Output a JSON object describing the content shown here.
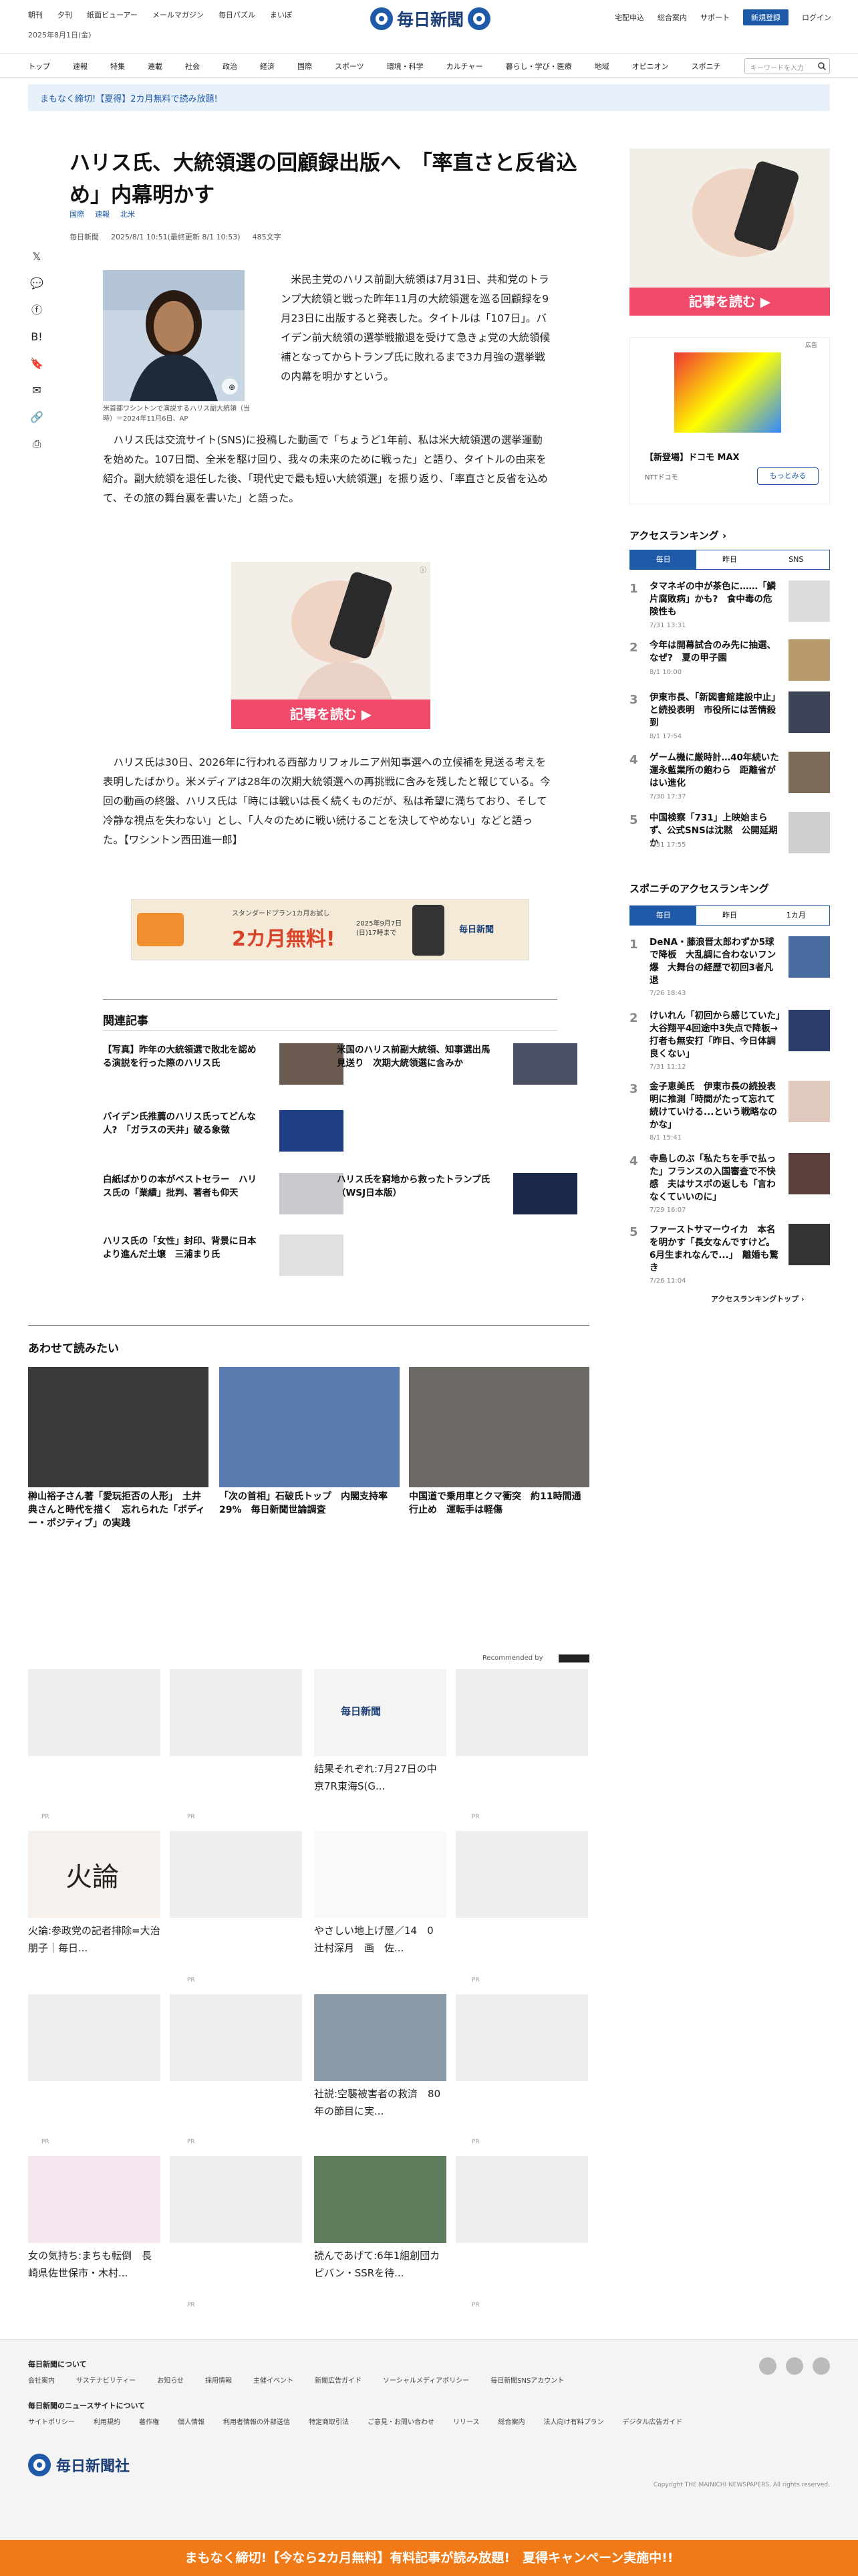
{
  "header": {
    "top_links": [
      "朝刊",
      "夕刊",
      "紙面ビューアー",
      "メールマガジン",
      "毎日パズル",
      "まいぽ"
    ],
    "right_links": [
      "宅配申込",
      "総合案内",
      "サポート"
    ],
    "register": "新規登録",
    "login": "ログイン",
    "date": "2025年8月1日(金)",
    "logo": "毎日新聞"
  },
  "nav": {
    "items": [
      "トップ",
      "速報",
      "特集",
      "連載",
      "社会",
      "政治",
      "経済",
      "国際",
      "スポーツ",
      "環境・科学",
      "カルチャー",
      "暮らし・学び・医療",
      "地域",
      "オピニオン",
      "スポニチ"
    ],
    "search_placeholder": "キーワードを入力"
  },
  "banner": "まもなく締切!【夏得】2カ月無料で読み放題!",
  "article": {
    "title": "ハリス氏、大統領選の回顧録出版へ　「率直さと反省込め」内幕明かす",
    "tags": [
      "国際",
      "速報",
      "北米"
    ],
    "meta": [
      "毎日新聞",
      "2025/8/1 10:51(最終更新 8/1 10:53)",
      "485文字"
    ],
    "caption": "米首都ワシントンで演説するハリス副大統領（当時）＝2024年11月6日、AP",
    "p1": "米民主党のハリス前副大統領は7月31日、共和党のトランプ大統領と戦った昨年11月の大統領選を巡る回顧録を9月23日に出版すると発表した。タイトルは「107日」。バイデン前大統領の選挙戦撤退を受けて急きょ党の大統領候補となってからトランプ氏に敗れるまで3カ月強の選挙戦の内幕を明かすという。",
    "p2": "ハリス氏は交流サイト(SNS)に投稿した動画で「ちょうど1年前、私は米大統領選の選挙運動を始めた。107日間、全米を駆け回り、我々の未来のために戦った」と語り、タイトルの由来を紹介。副大統領を退任した後、「現代史で最も短い大統領選」を振り返り、「率直さと反省を込めて、その旅の舞台裏を書いた」と語った。",
    "p3": "ハリス氏は30日、2026年に行われる西部カリフォルニア州知事選への立候補を見送る考えを表明したばかり。米メディアは28年の次期大統領選への再挑戦に含みを残したと報じている。今回の動画の終盤、ハリス氏は「時には戦いは長く続くものだが、私は希望に満ちており、そして冷静な視点を失わない」とし、「人々のために戦い続けることを決してやめない」などと語った。【ワシントン西田進一郎】"
  },
  "ads": {
    "read_button": "記事を読む",
    "mid_banner": "スタンダードプラン1カ月お試し",
    "mid_banner_main": "2カ月無料!",
    "mid_banner_date": "2025年9月7日(日)17時まで",
    "docomo": "【新登場】ドコモ MAX",
    "docomo_sub": "NTTドコモ",
    "docomo_btn": "もっとみる",
    "docomo_label": "広告",
    "recommended": "Recommended by"
  },
  "related": {
    "heading": "関連記事",
    "items": [
      "【写真】昨年の大統領選で敗北を認める演説を行った際のハリス氏",
      "米国のハリス前副大統領、知事選出馬見送り　次期大統領選に含みか",
      "バイデン氏推薦のハリス氏ってどんな人?　「ガラスの天井」破る象徴",
      "",
      "白紙ばかりの本がベストセラー　ハリス氏の「業績」批判、著者も仰天",
      "ハリス氏を窮地から救ったトランプ氏（WSJ日本版）",
      "ハリス氏の「女性」封印、背景に日本より進んだ土壌　三浦まり氏"
    ]
  },
  "also_read": {
    "heading": "あわせて読みたい",
    "items": [
      "榊山裕子さん著「愛玩拒否の人形」　土井典さんと時代を描く　忘れられた「ボディー・ポジティブ」の実践",
      "「次の首相」石破氏トップ　内閣支持率29%　毎日新聞世論調査",
      "中国道で乗用車とクマ衝突　約11時間通行止め　運転手は軽傷"
    ]
  },
  "grid": {
    "pr": "PR",
    "titles": [
      "結果それぞれ:7月27日の中京7R東海S(G...",
      "火論:参政党の記者排除=大治朋子｜毎日...",
      "やさしい地上げ屋／14　0　辻村深月　画　佐...",
      "社説:空襲被害者の救済　80年の節目に実...",
      "女の気持ち:まちも転倒　長崎県佐世保市・木村...",
      "読んであげて:6年1組創団カピバン・SSRを待..."
    ]
  },
  "ranking": {
    "heading": "アクセスランキング",
    "tabs": [
      "毎日",
      "昨日",
      "SNS"
    ],
    "items": [
      {
        "t": "タマネギの中が茶色に……「鱗片腐敗病」かも?　食中毒の危険性も",
        "d": "7/31 13:31"
      },
      {
        "t": "今年は開幕試合のみ先に抽選、なぜ?　夏の甲子園",
        "d": "8/1 10:00"
      },
      {
        "t": "伊東市長、「新図書館建設中止」と続投表明　市役所には苦情殺到",
        "d": "8/1 17:54"
      },
      {
        "t": "ゲーム機に厳時計…40年続いた運永藍業所の飽わら　距離省がはい進化",
        "d": "7/30 17:37"
      },
      {
        "t": "中国検察「731」上映始まらず、公式SNSは沈黙　公開延期か",
        "d": "7/31 17:55"
      }
    ],
    "sponichi_heading": "スポニチのアクセスランキング",
    "sponichi_tabs": [
      "毎日",
      "昨日",
      "1カ月"
    ],
    "sponichi": [
      {
        "t": "DeNA・藤浪晋太郎わずか5球で降板　大乱調に合わないフン爆　大舞台の経歴で初回3者凡退",
        "d": "7/26 18:43"
      },
      {
        "t": "けいれん「初回から感じていた」大谷翔平4回途中3失点で降板→打者も無安打「昨日、今日体調良くない」",
        "d": "7/31 11:12"
      },
      {
        "t": "金子恵美氏　伊東市長の続投表明に推測「時間がたって忘れて続けていける...という戦略なのかな」",
        "d": "8/1 15:41"
      },
      {
        "t": "寺島しのぶ「私たちを手で払った」フランスの入国審査で不快感　夫はサスポの返しも「言わなくていいのに」",
        "d": "7/29 16:07"
      },
      {
        "t": "ファーストサマーウイカ　本名を明かす「長女なんですけど。6月生まれなんで...」　離婚も驚き",
        "d": "7/26 11:04"
      }
    ],
    "more": "アクセスランキングトップ"
  },
  "footer": {
    "about": "毎日新聞について",
    "about_links": [
      "会社案内",
      "サステナビリティー",
      "お知らせ",
      "採用情報",
      "主催イベント",
      "新聞広告ガイド",
      "ソーシャルメディアポリシー",
      "毎日新聞SNSアカウント"
    ],
    "site": "毎日新聞のニュースサイトについて",
    "site_links": [
      "サイトポリシー",
      "利用規約",
      "著作権",
      "個人情報",
      "利用者情報の外部送信",
      "特定商取引法",
      "ご意見・お問い合わせ",
      "リリース",
      "総合案内",
      "法人向け有料プラン",
      "デジタル広告ガイド"
    ],
    "company": "毎日新聞社",
    "copyright": "Copyright THE MAINICHI NEWSPAPERS. All rights reserved."
  },
  "bottom_bar": "まもなく締切!【今なら2カ月無料】有料記事が読み放題!　夏得キャンペーン実施中!!",
  "colors": {
    "accent": "#1e5aa8",
    "cta": "#ef4a6a",
    "orange": "#f07a18"
  }
}
